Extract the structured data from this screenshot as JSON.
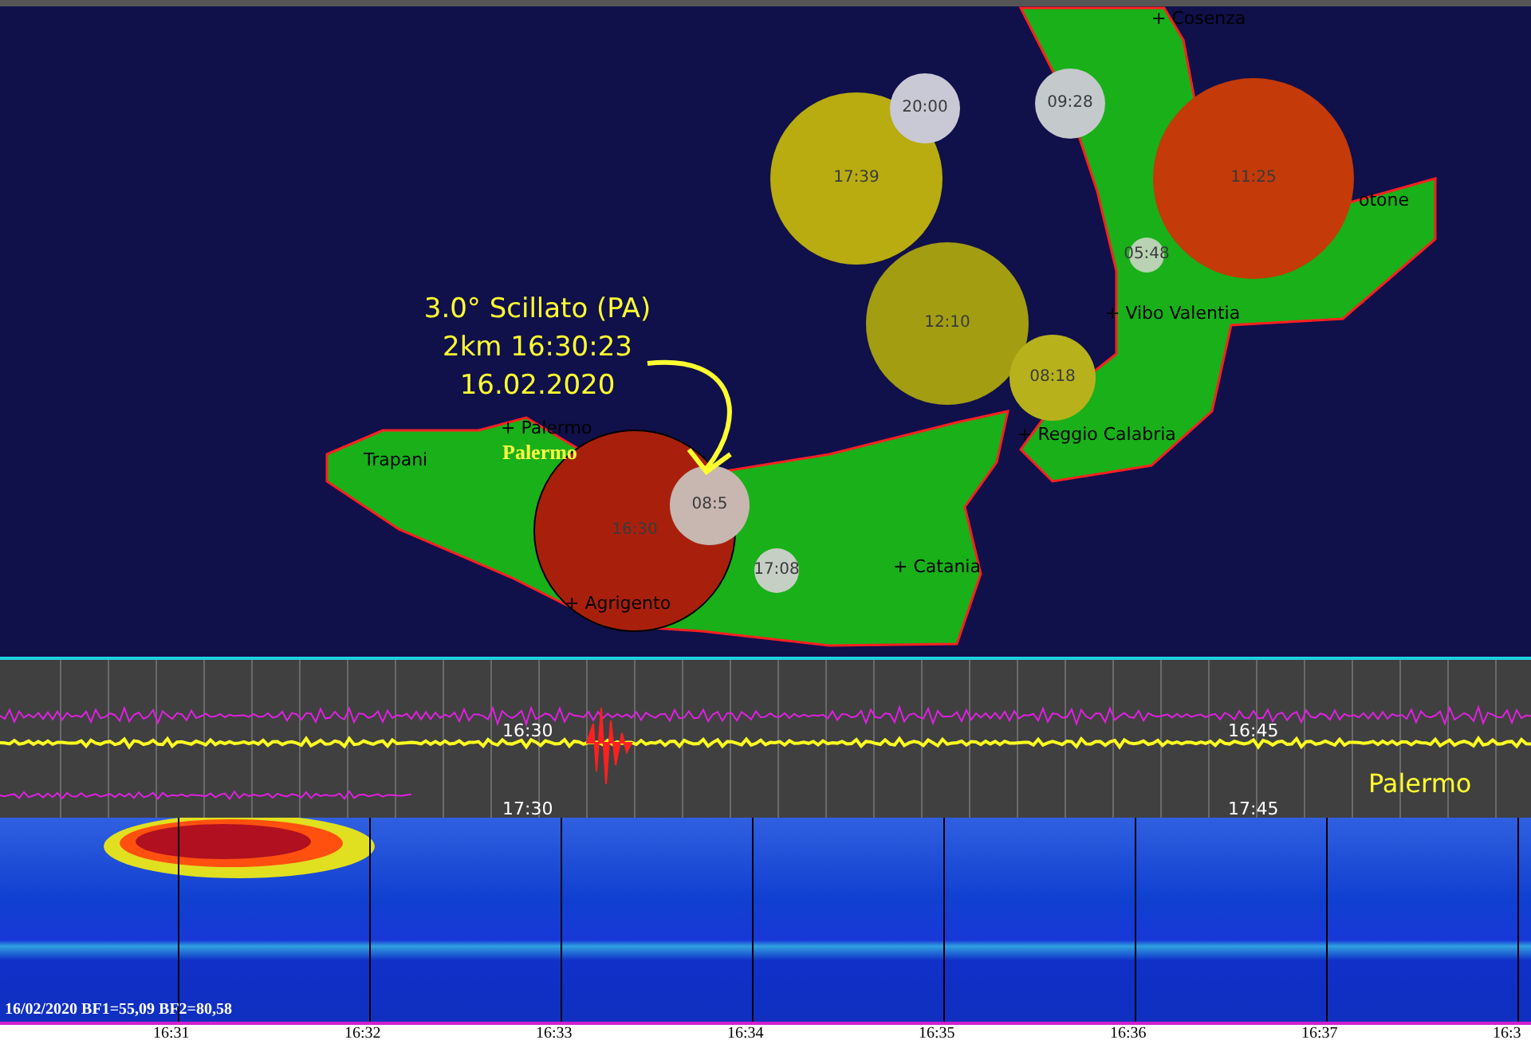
{
  "map": {
    "annotation": [
      "3.0° Scillato (PA)",
      "2km 16:30:23",
      "16.02.2020"
    ],
    "station_label": "Palermo",
    "cities": [
      {
        "label": "+ Cosenza"
      },
      {
        "label": "otone"
      },
      {
        "label": "+ Vibo Valentia"
      },
      {
        "label": "+ Palermo"
      },
      {
        "label": "+ Reggio Calabria"
      },
      {
        "label": "Trapani"
      },
      {
        "label": "+ Catania"
      },
      {
        "label": "+ Agrigento"
      }
    ],
    "events": [
      {
        "time": "17:39",
        "color": "#b8ac10"
      },
      {
        "time": "12:10",
        "color": "#a39d12"
      },
      {
        "time": "20:00",
        "color": "#c9c9d6"
      },
      {
        "time": "09:28",
        "color": "#c4c9cc"
      },
      {
        "time": "11:25",
        "color": "#c43a08"
      },
      {
        "time": "05:48",
        "color": "#b9d2b4"
      },
      {
        "time": "08:18",
        "color": "#b7b21c"
      },
      {
        "time": "16:30",
        "color": "#a8200c"
      },
      {
        "time": "08:5",
        "color": "#c8b6b0"
      },
      {
        "time": "17:08",
        "color": "#c6cfc4"
      }
    ]
  },
  "seismogram": {
    "time_labels": [
      "16:30",
      "16:45",
      "17:30",
      "17:45"
    ],
    "station": "Palermo"
  },
  "spectrogram": {
    "info": "16/02/2020 BF1=55,09 BF2=80,58",
    "time_labels": [
      "16:31",
      "16:32",
      "16:33",
      "16:34",
      "16:35",
      "16:36",
      "16:37",
      "16:3"
    ]
  }
}
